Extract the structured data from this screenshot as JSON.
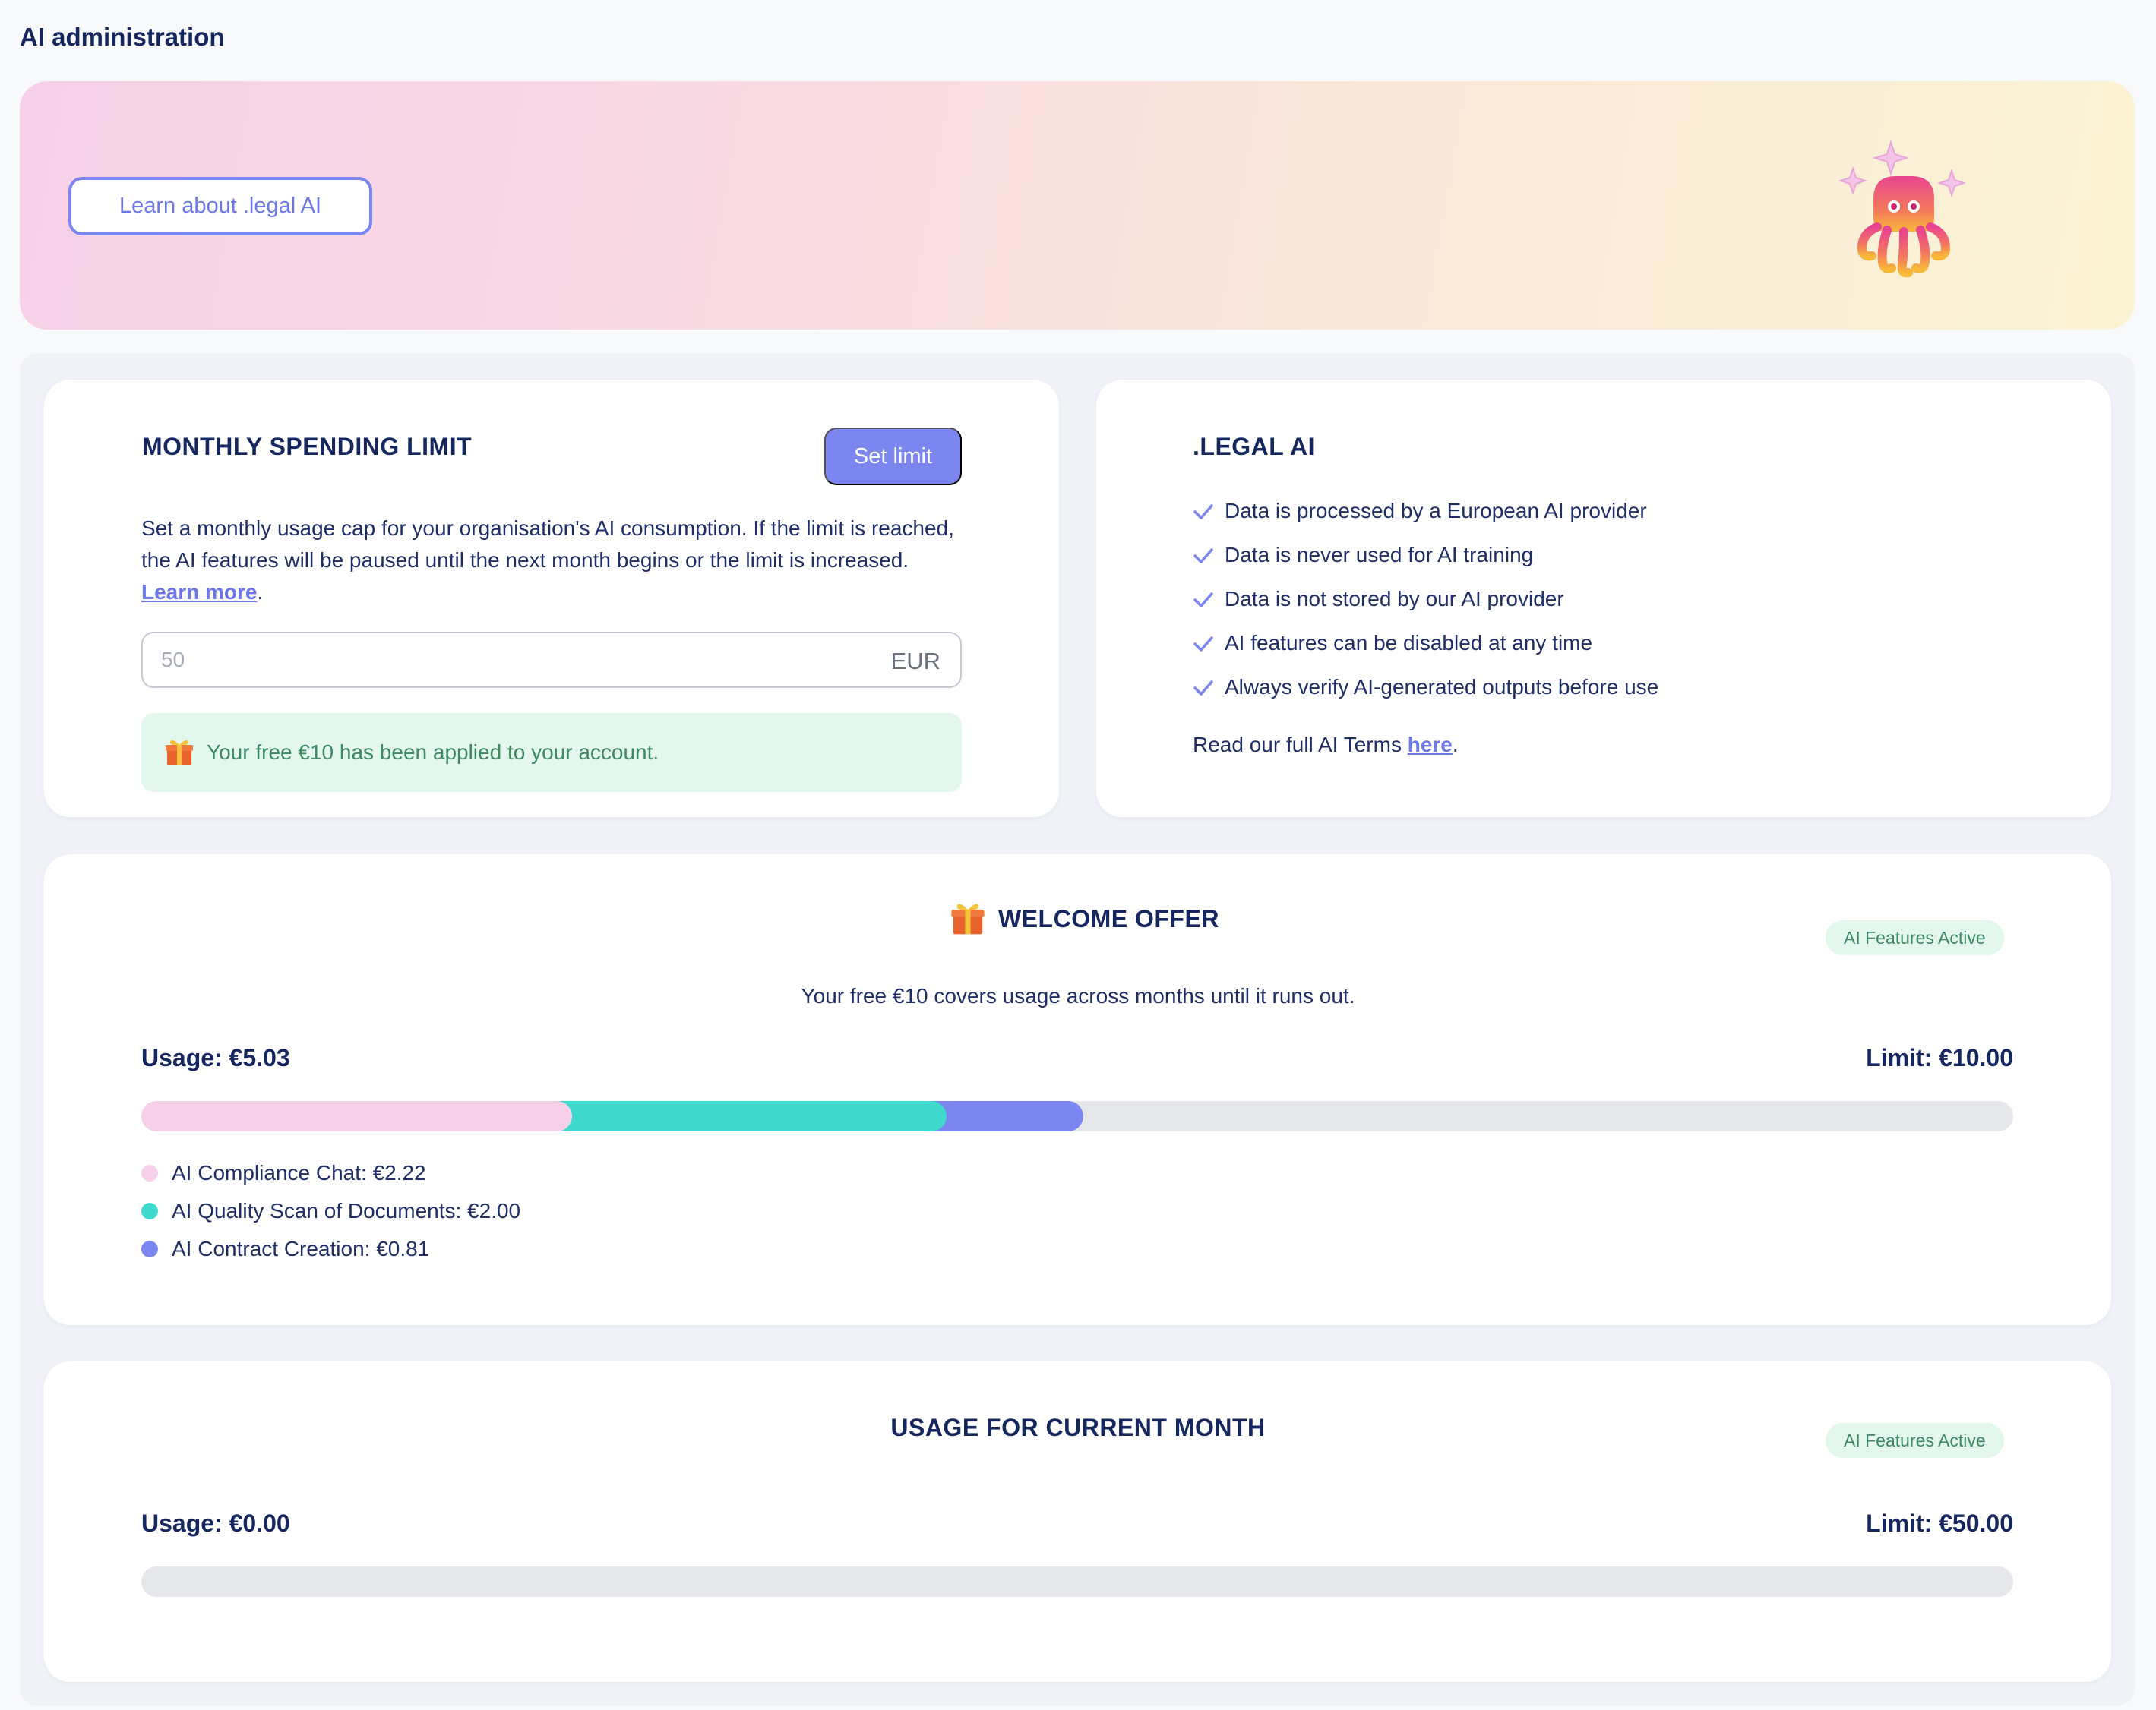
{
  "page": {
    "title": "AI administration"
  },
  "banner": {
    "learn_button": "Learn about .legal AI",
    "mascot_icon": "octopus-mascot-icon"
  },
  "spending": {
    "title": "MONTHLY SPENDING LIMIT",
    "set_limit_button": "Set limit",
    "description": "Set a monthly usage cap for your organisation's AI consumption. If the limit is reached, the AI features will be paused until the next month begins or the limit is increased.",
    "learn_more": "Learn more",
    "period": ".",
    "input_placeholder": "50",
    "input_value": "",
    "currency": "EUR",
    "free_note": "Your free €10 has been applied to your account."
  },
  "legal_ai": {
    "title": ".LEGAL AI",
    "items": [
      "Data is processed by a European AI provider",
      "Data is never used for AI training",
      "Data is not stored by our AI provider",
      "AI features can be disabled at any time",
      "Always verify AI-generated outputs before use"
    ],
    "terms_prefix": "Read our full AI Terms ",
    "terms_link": "here",
    "terms_suffix": "."
  },
  "welcome": {
    "title": "WELCOME OFFER",
    "badge": "AI Features Active",
    "subtitle": "Your free €10 covers usage across months until it runs out.",
    "usage": "Usage: €5.03",
    "limit": "Limit: €10.00",
    "limit_value": 10.0,
    "breakdown": [
      {
        "label": "AI Compliance Chat: €2.22",
        "value": 2.22,
        "color": "#f6d0e8"
      },
      {
        "label": "AI Quality Scan of Documents: €2.00",
        "value": 2.0,
        "color": "#3fd9cd"
      },
      {
        "label": "AI Contract Creation: €0.81",
        "value": 0.81,
        "color": "#7b86f0"
      }
    ]
  },
  "month": {
    "title": "USAGE FOR CURRENT MONTH",
    "badge": "AI Features Active",
    "usage": "Usage: €0.00",
    "limit": "Limit: €50.00",
    "usage_value": 0.0,
    "limit_value": 50.0
  },
  "colors": {
    "accent": "#7b86f0",
    "navy": "#15275e",
    "success_bg": "#e4f7ec",
    "success_text": "#3b8a62"
  }
}
